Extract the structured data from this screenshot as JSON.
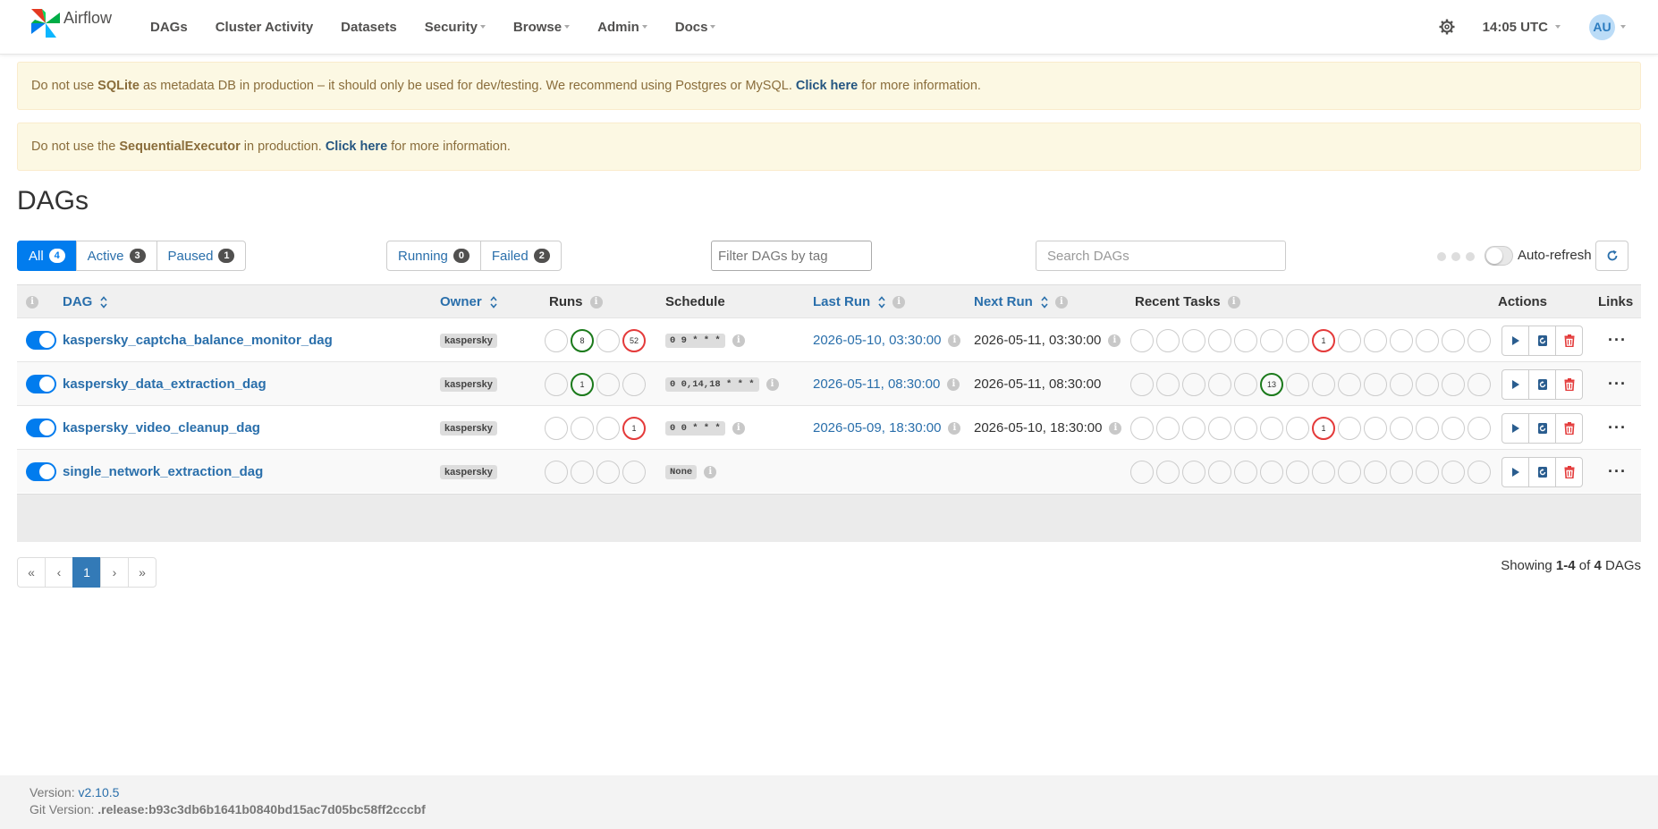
{
  "nav": {
    "brand": "Airflow",
    "items": [
      "DAGs",
      "Cluster Activity",
      "Datasets",
      "Security",
      "Browse",
      "Admin",
      "Docs"
    ],
    "time": "14:05 UTC",
    "user_initials": "AU"
  },
  "alerts": {
    "sqlite": {
      "prefix": "Do not use",
      "strong": "SQLite",
      "middle": "as metadata DB in production – it should only be used for dev/testing. We recommend using Postgres or MySQL.",
      "link": "Click here",
      "suffix": "for more information."
    },
    "executor": {
      "prefix": "Do not use the",
      "strong": "SequentialExecutor",
      "middle": "in production.",
      "link": "Click here",
      "suffix": "for more information."
    }
  },
  "page_title": "DAGs",
  "filters": {
    "all": {
      "label": "All",
      "count": "4"
    },
    "active": {
      "label": "Active",
      "count": "3"
    },
    "paused": {
      "label": "Paused",
      "count": "1"
    },
    "running": {
      "label": "Running",
      "count": "0"
    },
    "failed": {
      "label": "Failed",
      "count": "2"
    },
    "tag_placeholder": "Filter DAGs by tag",
    "search_placeholder": "Search DAGs",
    "auto_refresh": "Auto-refresh"
  },
  "table": {
    "headers": {
      "dag": "DAG",
      "owner": "Owner",
      "runs": "Runs",
      "schedule": "Schedule",
      "last_run": "Last Run",
      "next_run": "Next Run",
      "recent_tasks": "Recent Tasks",
      "actions": "Actions",
      "links": "Links"
    },
    "rows": [
      {
        "name": "kaspersky_captcha_balance_monitor_dag",
        "owner": "kaspersky",
        "runs": [
          {
            "v": ""
          },
          {
            "v": "8",
            "s": "green"
          },
          {
            "v": ""
          },
          {
            "v": "52",
            "s": "red"
          }
        ],
        "schedule": "0 9 * * *",
        "last_run": "2026-05-10, 03:30:00",
        "next_run": "2026-05-11, 03:30:00",
        "next_info": true,
        "tasks": {
          "index": 7,
          "v": "1",
          "s": "red"
        }
      },
      {
        "name": "kaspersky_data_extraction_dag",
        "owner": "kaspersky",
        "runs": [
          {
            "v": ""
          },
          {
            "v": "1",
            "s": "green"
          },
          {
            "v": ""
          },
          {
            "v": ""
          }
        ],
        "schedule": "0 0,14,18 * * *",
        "last_run": "2026-05-11, 08:30:00",
        "next_run": "2026-05-11, 08:30:00",
        "next_info": false,
        "tasks": {
          "index": 5,
          "v": "13",
          "s": "green"
        }
      },
      {
        "name": "kaspersky_video_cleanup_dag",
        "owner": "kaspersky",
        "runs": [
          {
            "v": ""
          },
          {
            "v": ""
          },
          {
            "v": ""
          },
          {
            "v": "1",
            "s": "red"
          }
        ],
        "schedule": "0 0 * * *",
        "last_run": "2026-05-09, 18:30:00",
        "next_run": "2026-05-10, 18:30:00",
        "next_info": true,
        "tasks": {
          "index": 7,
          "v": "1",
          "s": "red"
        }
      },
      {
        "name": "single_network_extraction_dag",
        "owner": "kaspersky",
        "runs": [
          {
            "v": ""
          },
          {
            "v": ""
          },
          {
            "v": ""
          },
          {
            "v": ""
          }
        ],
        "schedule": "None",
        "last_run": "",
        "next_run": "",
        "next_info": false,
        "tasks": {
          "index": -1,
          "v": "",
          "s": ""
        }
      }
    ]
  },
  "pagination": {
    "first": "«",
    "prev": "‹",
    "current": "1",
    "next": "›",
    "last": "»"
  },
  "showing": {
    "prefix": "Showing",
    "range": "1-4",
    "of": "of",
    "total": "4",
    "suffix": "DAGs"
  },
  "footer": {
    "version_label": "Version:",
    "version": "v2.10.5",
    "git_label": "Git Version:",
    "git": ".release:b93c3db6b1641b0840bd15ac7d05bc58ff2cccbf"
  },
  "colors": {
    "accent": "#017cee",
    "link": "#2a6fab",
    "success": "#1b7a1b",
    "failed": "#e43a3a",
    "warning_bg": "#fcf8e3"
  }
}
